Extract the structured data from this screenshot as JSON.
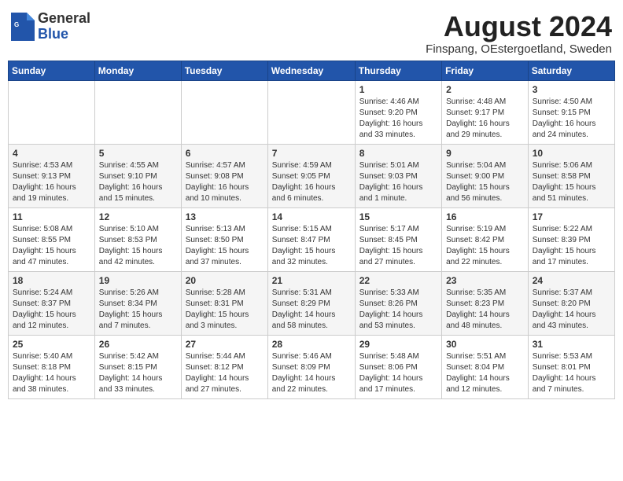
{
  "header": {
    "logo_general": "General",
    "logo_blue": "Blue",
    "month_year": "August 2024",
    "location": "Finspang, OEstergoetland, Sweden"
  },
  "days_of_week": [
    "Sunday",
    "Monday",
    "Tuesday",
    "Wednesday",
    "Thursday",
    "Friday",
    "Saturday"
  ],
  "weeks": [
    [
      {
        "day": "",
        "info": ""
      },
      {
        "day": "",
        "info": ""
      },
      {
        "day": "",
        "info": ""
      },
      {
        "day": "",
        "info": ""
      },
      {
        "day": "1",
        "info": "Sunrise: 4:46 AM\nSunset: 9:20 PM\nDaylight: 16 hours\nand 33 minutes."
      },
      {
        "day": "2",
        "info": "Sunrise: 4:48 AM\nSunset: 9:17 PM\nDaylight: 16 hours\nand 29 minutes."
      },
      {
        "day": "3",
        "info": "Sunrise: 4:50 AM\nSunset: 9:15 PM\nDaylight: 16 hours\nand 24 minutes."
      }
    ],
    [
      {
        "day": "4",
        "info": "Sunrise: 4:53 AM\nSunset: 9:13 PM\nDaylight: 16 hours\nand 19 minutes."
      },
      {
        "day": "5",
        "info": "Sunrise: 4:55 AM\nSunset: 9:10 PM\nDaylight: 16 hours\nand 15 minutes."
      },
      {
        "day": "6",
        "info": "Sunrise: 4:57 AM\nSunset: 9:08 PM\nDaylight: 16 hours\nand 10 minutes."
      },
      {
        "day": "7",
        "info": "Sunrise: 4:59 AM\nSunset: 9:05 PM\nDaylight: 16 hours\nand 6 minutes."
      },
      {
        "day": "8",
        "info": "Sunrise: 5:01 AM\nSunset: 9:03 PM\nDaylight: 16 hours\nand 1 minute."
      },
      {
        "day": "9",
        "info": "Sunrise: 5:04 AM\nSunset: 9:00 PM\nDaylight: 15 hours\nand 56 minutes."
      },
      {
        "day": "10",
        "info": "Sunrise: 5:06 AM\nSunset: 8:58 PM\nDaylight: 15 hours\nand 51 minutes."
      }
    ],
    [
      {
        "day": "11",
        "info": "Sunrise: 5:08 AM\nSunset: 8:55 PM\nDaylight: 15 hours\nand 47 minutes."
      },
      {
        "day": "12",
        "info": "Sunrise: 5:10 AM\nSunset: 8:53 PM\nDaylight: 15 hours\nand 42 minutes."
      },
      {
        "day": "13",
        "info": "Sunrise: 5:13 AM\nSunset: 8:50 PM\nDaylight: 15 hours\nand 37 minutes."
      },
      {
        "day": "14",
        "info": "Sunrise: 5:15 AM\nSunset: 8:47 PM\nDaylight: 15 hours\nand 32 minutes."
      },
      {
        "day": "15",
        "info": "Sunrise: 5:17 AM\nSunset: 8:45 PM\nDaylight: 15 hours\nand 27 minutes."
      },
      {
        "day": "16",
        "info": "Sunrise: 5:19 AM\nSunset: 8:42 PM\nDaylight: 15 hours\nand 22 minutes."
      },
      {
        "day": "17",
        "info": "Sunrise: 5:22 AM\nSunset: 8:39 PM\nDaylight: 15 hours\nand 17 minutes."
      }
    ],
    [
      {
        "day": "18",
        "info": "Sunrise: 5:24 AM\nSunset: 8:37 PM\nDaylight: 15 hours\nand 12 minutes."
      },
      {
        "day": "19",
        "info": "Sunrise: 5:26 AM\nSunset: 8:34 PM\nDaylight: 15 hours\nand 7 minutes."
      },
      {
        "day": "20",
        "info": "Sunrise: 5:28 AM\nSunset: 8:31 PM\nDaylight: 15 hours\nand 3 minutes."
      },
      {
        "day": "21",
        "info": "Sunrise: 5:31 AM\nSunset: 8:29 PM\nDaylight: 14 hours\nand 58 minutes."
      },
      {
        "day": "22",
        "info": "Sunrise: 5:33 AM\nSunset: 8:26 PM\nDaylight: 14 hours\nand 53 minutes."
      },
      {
        "day": "23",
        "info": "Sunrise: 5:35 AM\nSunset: 8:23 PM\nDaylight: 14 hours\nand 48 minutes."
      },
      {
        "day": "24",
        "info": "Sunrise: 5:37 AM\nSunset: 8:20 PM\nDaylight: 14 hours\nand 43 minutes."
      }
    ],
    [
      {
        "day": "25",
        "info": "Sunrise: 5:40 AM\nSunset: 8:18 PM\nDaylight: 14 hours\nand 38 minutes."
      },
      {
        "day": "26",
        "info": "Sunrise: 5:42 AM\nSunset: 8:15 PM\nDaylight: 14 hours\nand 33 minutes."
      },
      {
        "day": "27",
        "info": "Sunrise: 5:44 AM\nSunset: 8:12 PM\nDaylight: 14 hours\nand 27 minutes."
      },
      {
        "day": "28",
        "info": "Sunrise: 5:46 AM\nSunset: 8:09 PM\nDaylight: 14 hours\nand 22 minutes."
      },
      {
        "day": "29",
        "info": "Sunrise: 5:48 AM\nSunset: 8:06 PM\nDaylight: 14 hours\nand 17 minutes."
      },
      {
        "day": "30",
        "info": "Sunrise: 5:51 AM\nSunset: 8:04 PM\nDaylight: 14 hours\nand 12 minutes."
      },
      {
        "day": "31",
        "info": "Sunrise: 5:53 AM\nSunset: 8:01 PM\nDaylight: 14 hours\nand 7 minutes."
      }
    ]
  ]
}
